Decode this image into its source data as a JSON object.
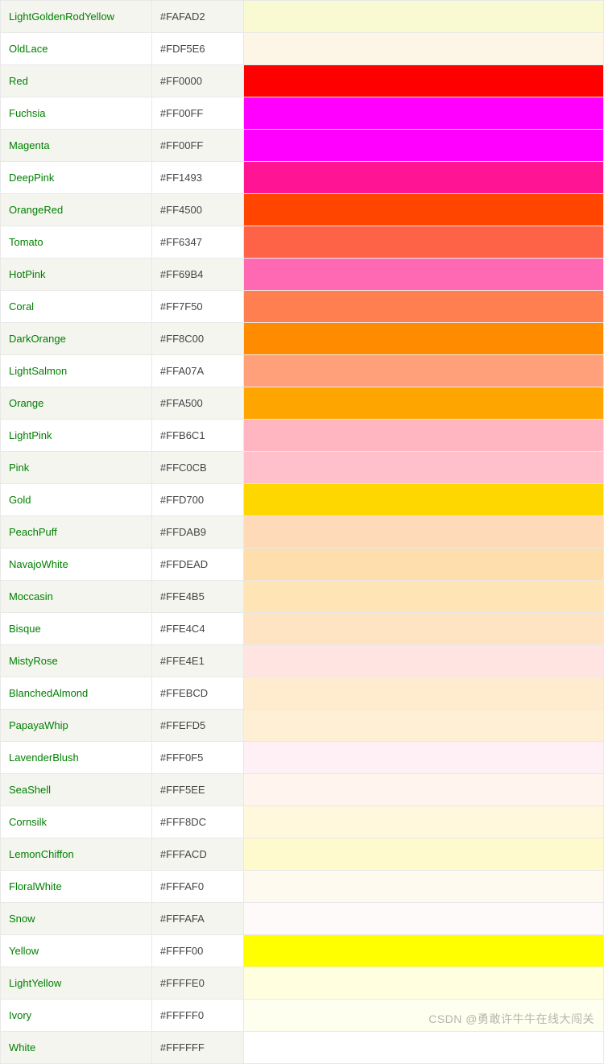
{
  "watermark": "CSDN @勇敢许牛牛在线大闯关",
  "colors": [
    {
      "name": "LightGoldenRodYellow",
      "hex": "#FAFAD2"
    },
    {
      "name": "OldLace",
      "hex": "#FDF5E6"
    },
    {
      "name": "Red",
      "hex": "#FF0000"
    },
    {
      "name": "Fuchsia",
      "hex": "#FF00FF"
    },
    {
      "name": "Magenta",
      "hex": "#FF00FF"
    },
    {
      "name": "DeepPink",
      "hex": "#FF1493"
    },
    {
      "name": "OrangeRed",
      "hex": "#FF4500"
    },
    {
      "name": "Tomato",
      "hex": "#FF6347"
    },
    {
      "name": "HotPink",
      "hex": "#FF69B4"
    },
    {
      "name": "Coral",
      "hex": "#FF7F50"
    },
    {
      "name": "DarkOrange",
      "hex": "#FF8C00"
    },
    {
      "name": "LightSalmon",
      "hex": "#FFA07A"
    },
    {
      "name": "Orange",
      "hex": "#FFA500"
    },
    {
      "name": "LightPink",
      "hex": "#FFB6C1"
    },
    {
      "name": "Pink",
      "hex": "#FFC0CB"
    },
    {
      "name": "Gold",
      "hex": "#FFD700"
    },
    {
      "name": "PeachPuff",
      "hex": "#FFDAB9"
    },
    {
      "name": "NavajoWhite",
      "hex": "#FFDEAD"
    },
    {
      "name": "Moccasin",
      "hex": "#FFE4B5"
    },
    {
      "name": "Bisque",
      "hex": "#FFE4C4"
    },
    {
      "name": "MistyRose",
      "hex": "#FFE4E1"
    },
    {
      "name": "BlanchedAlmond",
      "hex": "#FFEBCD"
    },
    {
      "name": "PapayaWhip",
      "hex": "#FFEFD5"
    },
    {
      "name": "LavenderBlush",
      "hex": "#FFF0F5"
    },
    {
      "name": "SeaShell",
      "hex": "#FFF5EE"
    },
    {
      "name": "Cornsilk",
      "hex": "#FFF8DC"
    },
    {
      "name": "LemonChiffon",
      "hex": "#FFFACD"
    },
    {
      "name": "FloralWhite",
      "hex": "#FFFAF0"
    },
    {
      "name": "Snow",
      "hex": "#FFFAFA"
    },
    {
      "name": "Yellow",
      "hex": "#FFFF00"
    },
    {
      "name": "LightYellow",
      "hex": "#FFFFE0"
    },
    {
      "name": "Ivory",
      "hex": "#FFFFF0"
    },
    {
      "name": "White",
      "hex": "#FFFFFF"
    }
  ]
}
